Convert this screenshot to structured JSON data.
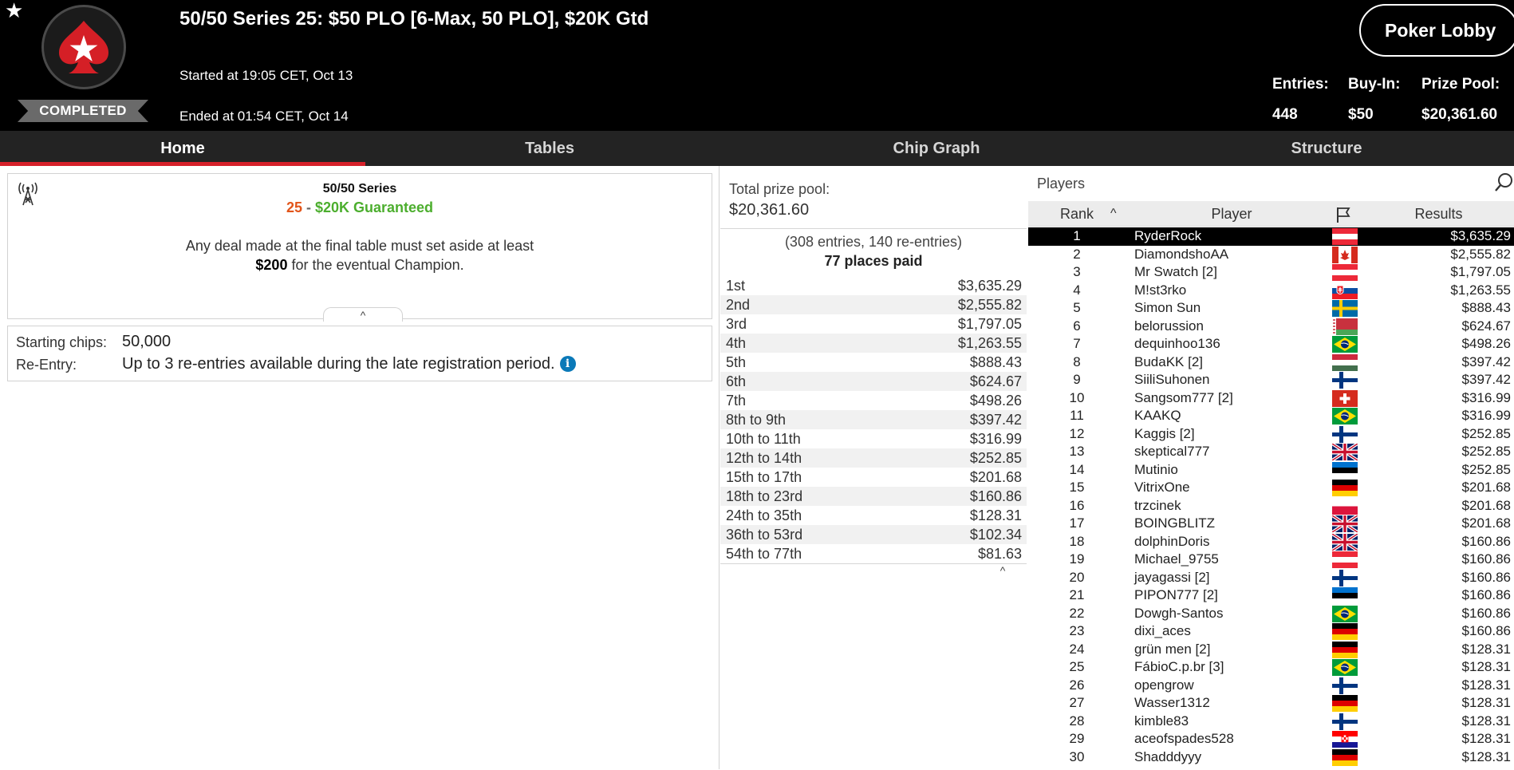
{
  "header": {
    "title": "50/50 Series 25: $50 PLO [6-Max, 50 PLO], $20K Gtd",
    "started": "Started at 19:05 CET, Oct 13",
    "ended": "Ended at 01:54 CET, Oct 14",
    "status": "COMPLETED",
    "lobby_button": "Poker Lobby",
    "stats": {
      "entries_label": "Entries:",
      "entries_value": "448",
      "buyin_label": "Buy-In:",
      "buyin_value": "$50",
      "prizepool_label": "Prize Pool:",
      "prizepool_value": "$20,361.60"
    }
  },
  "tabs": [
    {
      "label": "Home",
      "active": true
    },
    {
      "label": "Tables",
      "active": false
    },
    {
      "label": "Chip Graph",
      "active": false
    },
    {
      "label": "Structure",
      "active": false
    }
  ],
  "info": {
    "series_name": "50/50 Series",
    "series_number": "25",
    "series_separator": " - ",
    "guarantee": "$20K Guaranteed",
    "deal_line1": "Any deal made at the final table must set aside at least",
    "deal_amount": "$200",
    "deal_line2": " for the eventual Champion.",
    "collapse_glyph": "^",
    "starting_chips_label": "Starting chips:",
    "starting_chips_value": "50,000",
    "reentry_label": "Re-Entry:",
    "reentry_value": "Up to 3 re-entries available during the late registration period.",
    "info_glyph": "i"
  },
  "prize": {
    "total_label": "Total prize pool:",
    "total_value": "$20,361.60",
    "entries_text": "(308 entries, 140 re-entries)",
    "places_paid": "77 places paid",
    "collapse_glyph": "^",
    "payouts": [
      {
        "place": "1st",
        "amount": "$3,635.29"
      },
      {
        "place": "2nd",
        "amount": "$2,555.82"
      },
      {
        "place": "3rd",
        "amount": "$1,797.05"
      },
      {
        "place": "4th",
        "amount": "$1,263.55"
      },
      {
        "place": "5th",
        "amount": "$888.43"
      },
      {
        "place": "6th",
        "amount": "$624.67"
      },
      {
        "place": "7th",
        "amount": "$498.26"
      },
      {
        "place": "8th to 9th",
        "amount": "$397.42"
      },
      {
        "place": "10th to 11th",
        "amount": "$316.99"
      },
      {
        "place": "12th to 14th",
        "amount": "$252.85"
      },
      {
        "place": "15th to 17th",
        "amount": "$201.68"
      },
      {
        "place": "18th to 23rd",
        "amount": "$160.86"
      },
      {
        "place": "24th to 35th",
        "amount": "$128.31"
      },
      {
        "place": "36th to 53rd",
        "amount": "$102.34"
      },
      {
        "place": "54th to 77th",
        "amount": "$81.63"
      }
    ]
  },
  "players": {
    "title": "Players",
    "columns": {
      "rank": "Rank",
      "player": "Player",
      "results": "Results"
    },
    "rows": [
      {
        "rank": "1",
        "name": "RyderRock",
        "flag": "austria",
        "result": "$3,635.29"
      },
      {
        "rank": "2",
        "name": "DiamondshoAA",
        "flag": "canada",
        "result": "$2,555.82"
      },
      {
        "rank": "3",
        "name": "Mr Swatch [2]",
        "flag": "austria",
        "result": "$1,797.05"
      },
      {
        "rank": "4",
        "name": "M!st3rko",
        "flag": "slovakia",
        "result": "$1,263.55"
      },
      {
        "rank": "5",
        "name": "Simon Sun",
        "flag": "sweden",
        "result": "$888.43"
      },
      {
        "rank": "6",
        "name": "belorussion",
        "flag": "belarus",
        "result": "$624.67"
      },
      {
        "rank": "7",
        "name": "dequinhoo136",
        "flag": "brazil",
        "result": "$498.26"
      },
      {
        "rank": "8",
        "name": "BudaKK [2]",
        "flag": "hungary",
        "result": "$397.42"
      },
      {
        "rank": "9",
        "name": "SiiliSuhonen",
        "flag": "finland",
        "result": "$397.42"
      },
      {
        "rank": "10",
        "name": "Sangsom777 [2]",
        "flag": "switzerland",
        "result": "$316.99"
      },
      {
        "rank": "11",
        "name": "KAAKQ",
        "flag": "brazil",
        "result": "$316.99"
      },
      {
        "rank": "12",
        "name": "Kaggis [2]",
        "flag": "finland",
        "result": "$252.85"
      },
      {
        "rank": "13",
        "name": "skeptical777",
        "flag": "uk",
        "result": "$252.85"
      },
      {
        "rank": "14",
        "name": "Mutinio",
        "flag": "estonia",
        "result": "$252.85"
      },
      {
        "rank": "15",
        "name": "VitrixOne",
        "flag": "germany",
        "result": "$201.68"
      },
      {
        "rank": "16",
        "name": "trzcinek",
        "flag": "poland",
        "result": "$201.68"
      },
      {
        "rank": "17",
        "name": "BOINGBLITZ",
        "flag": "uk",
        "result": "$201.68"
      },
      {
        "rank": "18",
        "name": "dolphinDoris",
        "flag": "uk",
        "result": "$160.86"
      },
      {
        "rank": "19",
        "name": "Michael_9755",
        "flag": "austria",
        "result": "$160.86"
      },
      {
        "rank": "20",
        "name": "jayagassi [2]",
        "flag": "finland",
        "result": "$160.86"
      },
      {
        "rank": "21",
        "name": "PIPON777 [2]",
        "flag": "estonia",
        "result": "$160.86"
      },
      {
        "rank": "22",
        "name": "Dowgh-Santos",
        "flag": "brazil",
        "result": "$160.86"
      },
      {
        "rank": "23",
        "name": "dixi_aces",
        "flag": "germany",
        "result": "$160.86"
      },
      {
        "rank": "24",
        "name": "grün men [2]",
        "flag": "germany",
        "result": "$128.31"
      },
      {
        "rank": "25",
        "name": "FábioC.p.br [3]",
        "flag": "brazil",
        "result": "$128.31"
      },
      {
        "rank": "26",
        "name": "opengrow",
        "flag": "finland",
        "result": "$128.31"
      },
      {
        "rank": "27",
        "name": "Wasser1312",
        "flag": "germany",
        "result": "$128.31"
      },
      {
        "rank": "28",
        "name": "kimble83",
        "flag": "finland",
        "result": "$128.31"
      },
      {
        "rank": "29",
        "name": "aceofspades528",
        "flag": "croatia",
        "result": "$128.31"
      },
      {
        "rank": "30",
        "name": "Shadddyyy",
        "flag": "germany",
        "result": "$128.31"
      }
    ]
  },
  "colors": {
    "header_bg": "#000000",
    "tab_bg": "#232323",
    "tab_active_underline": "#d6202a",
    "series_number": "#e2551a",
    "guarantee": "#4cae2e",
    "info_icon": "#0a79b8",
    "selected_row": "#000000"
  }
}
